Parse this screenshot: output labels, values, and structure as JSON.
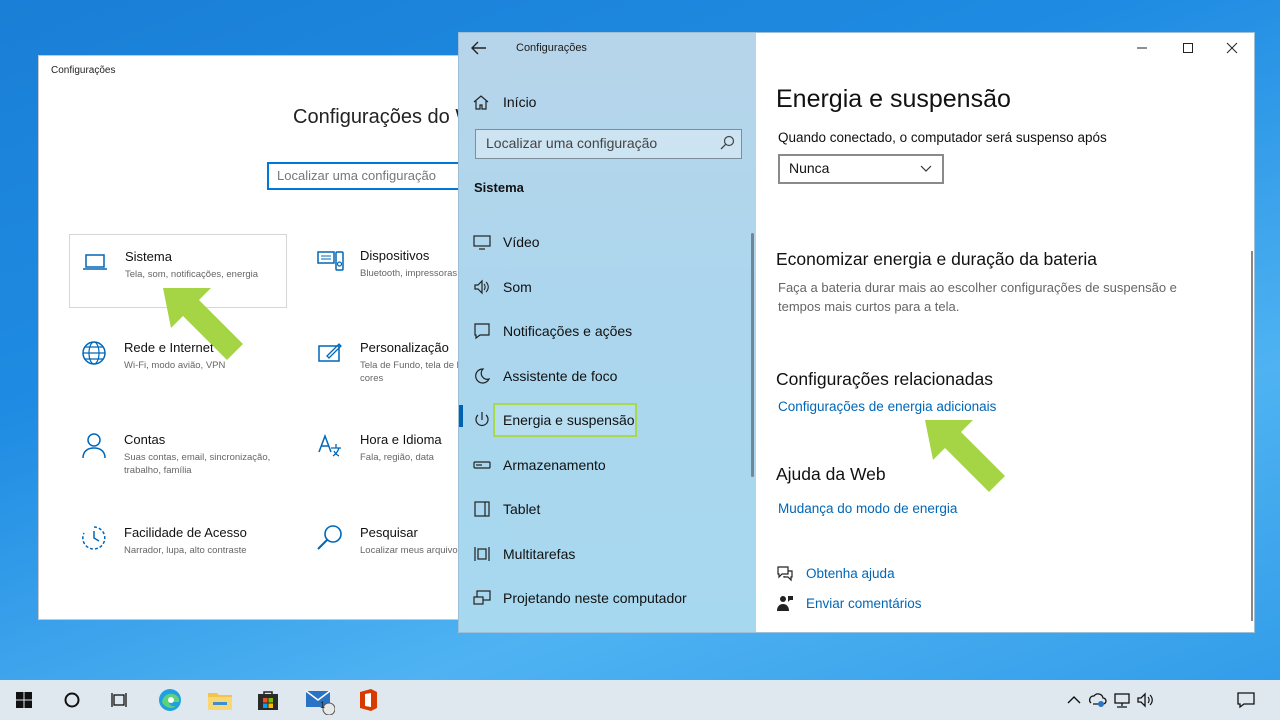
{
  "background_window": {
    "title": "Configurações",
    "heading": "Configurações do Windows",
    "search_placeholder": "Localizar uma configuração",
    "tiles": [
      {
        "name": "Sistema",
        "desc": "Tela, som, notificações, energia",
        "icon": "laptop-icon"
      },
      {
        "name": "Dispositivos",
        "desc": "Bluetooth, impressoras",
        "icon": "keyboard-devices-icon"
      },
      {
        "name": "Rede e Internet",
        "desc": "Wi-Fi, modo avião, VPN",
        "icon": "globe-icon"
      },
      {
        "name": "Personalização",
        "desc": "Tela de Fundo, tela de bloqueio, cores",
        "icon": "paint-icon"
      },
      {
        "name": "Contas",
        "desc": "Suas contas, email, sincronização, trabalho, família",
        "icon": "person-icon"
      },
      {
        "name": "Hora e Idioma",
        "desc": "Fala, região, data",
        "icon": "time-language-icon"
      },
      {
        "name": "Facilidade de Acesso",
        "desc": "Narrador, lupa, alto contraste",
        "icon": "ease-of-access-icon"
      },
      {
        "name": "Pesquisar",
        "desc": "Localizar meus arquivos, permissões",
        "icon": "search-icon"
      }
    ]
  },
  "window": {
    "title": "Configurações",
    "home_label": "Início",
    "search_placeholder": "Localizar uma configuração",
    "section": "Sistema",
    "nav_items": [
      {
        "label": "Vídeo",
        "icon": "display-icon"
      },
      {
        "label": "Som",
        "icon": "speaker-icon"
      },
      {
        "label": "Notificações e ações",
        "icon": "notifications-icon"
      },
      {
        "label": "Assistente de foco",
        "icon": "moon-icon"
      },
      {
        "label": "Energia e suspensão",
        "icon": "power-icon",
        "active": true
      },
      {
        "label": "Armazenamento",
        "icon": "storage-icon"
      },
      {
        "label": "Tablet",
        "icon": "tablet-icon"
      },
      {
        "label": "Multitarefas",
        "icon": "multitasking-icon"
      },
      {
        "label": "Projetando neste computador",
        "icon": "projecting-icon"
      }
    ]
  },
  "content": {
    "title": "Energia e suspensão",
    "plugged_label": "Quando conectado, o computador será suspenso após",
    "dropdown_value": "Nunca",
    "save_heading": "Economizar energia e duração da bateria",
    "save_desc": "Faça a bateria durar mais ao escolher configurações de suspensão e tempos mais curtos para a tela.",
    "related_heading": "Configurações relacionadas",
    "related_link": "Configurações de energia adicionais",
    "web_heading": "Ajuda da Web",
    "web_link": "Mudança do modo de energia",
    "get_help": "Obtenha ajuda",
    "feedback": "Enviar comentários"
  },
  "taskbar": {
    "mail_badge": "1"
  },
  "colors": {
    "accent": "#0078d7",
    "link": "#0067b8",
    "highlight": "#a7d94a"
  }
}
